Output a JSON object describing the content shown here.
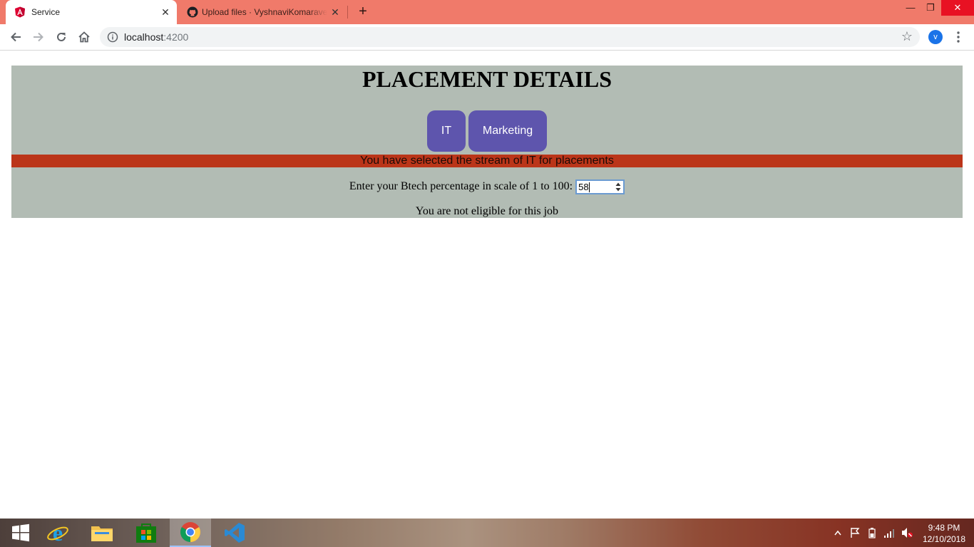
{
  "browser": {
    "tabs": [
      {
        "title": "Service",
        "icon": "angular-icon",
        "active": true
      },
      {
        "title": "Upload files · VyshnaviKomaravel",
        "icon": "github-icon",
        "active": false
      }
    ],
    "address": {
      "host": "localhost",
      "port": ":4200"
    },
    "profile_initial": "v"
  },
  "page": {
    "title": "PLACEMENT DETAILS",
    "buttons": {
      "it": "IT",
      "marketing": "Marketing"
    },
    "banner": "You have selected the stream of IT for placements",
    "question": "Enter your Btech percentage in scale of 1 to 100:",
    "percentage_value": "58",
    "result": "You are not eligible for this job"
  },
  "taskbar": {
    "apps": [
      "windows-start-icon",
      "internet-explorer-icon",
      "file-explorer-icon",
      "store-icon",
      "chrome-icon",
      "vscode-icon"
    ],
    "clock": {
      "time": "9:48 PM",
      "date": "12/10/2018"
    }
  },
  "colors": {
    "tabstrip": "#f07a6a",
    "app_background": "#b2bcb4",
    "button": "#5e55ad",
    "banner": "#bb3519"
  }
}
